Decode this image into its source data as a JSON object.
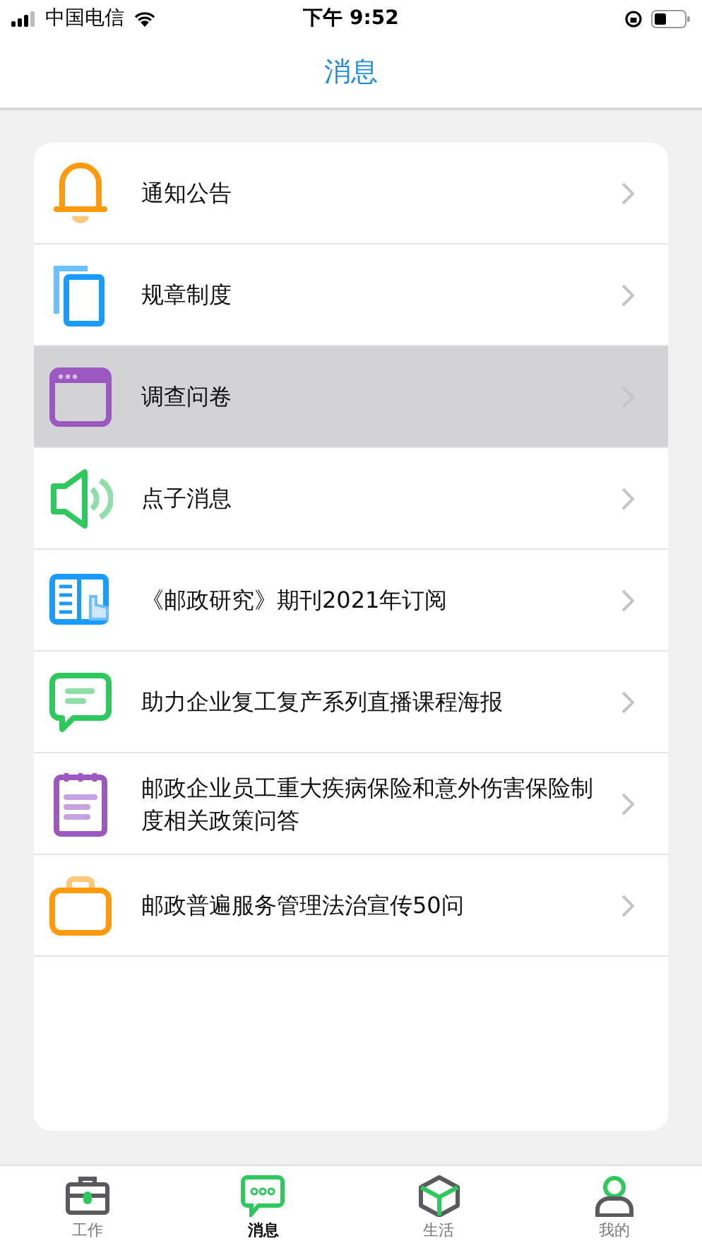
{
  "status_bar": {
    "carrier": "中国电信",
    "time": "下午 9:52"
  },
  "header": {
    "title": "消息"
  },
  "items": [
    {
      "label": "通知公告",
      "selected": false
    },
    {
      "label": "规章制度",
      "selected": false
    },
    {
      "label": "调查问卷",
      "selected": true
    },
    {
      "label": "点子消息",
      "selected": false
    },
    {
      "label": "《邮政研究》期刊2021年订阅",
      "selected": false
    },
    {
      "label": "助力企业复工复产系列直播课程海报",
      "selected": false
    },
    {
      "label": "邮政企业员工重大疾病保险和意外伤害保险制度相关政策问答",
      "selected": false
    },
    {
      "label": "邮政普遍服务管理法治宣传50问",
      "selected": false
    }
  ],
  "tabs": [
    {
      "label": "工作",
      "selected": false
    },
    {
      "label": "消息",
      "selected": true
    },
    {
      "label": "生活",
      "selected": false
    },
    {
      "label": "我的",
      "selected": false
    }
  ]
}
